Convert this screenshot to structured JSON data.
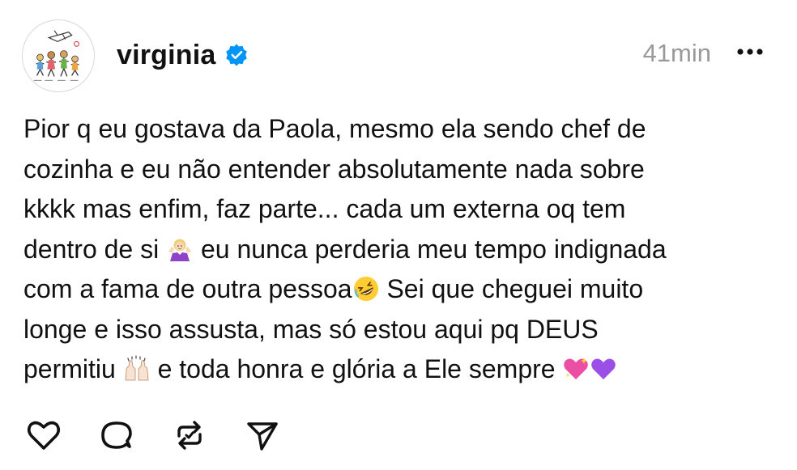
{
  "post": {
    "username": "virginia",
    "verified": true,
    "timestamp": "41min",
    "more_icon": "more-horizontal-icon",
    "text_lines": [
      {
        "text": "Pior q eu gostava da Paola, mesmo ela sendo chef de"
      },
      {
        "text": "cozinha e eu não entender absolutamente nada sobre"
      },
      {
        "text": "kkkk mas enfim, faz parte... cada um externa oq tem"
      },
      {
        "before": "dentro de si ",
        "emoji": "woman-shrugging-emoji",
        "after": " eu nunca perderia meu tempo indignada"
      },
      {
        "before": "com a fama de outra pessoa",
        "emoji": "rolling-laughing-emoji",
        "after": " Sei que cheguei muito"
      },
      {
        "text": "longe e isso assusta, mas só estou aqui pq DEUS"
      },
      {
        "before": "permitiu ",
        "emoji": "raising-hands-emoji",
        "after": " e toda honra e glória a Ele sempre ",
        "emoji2": "sparkling-heart-emoji",
        "emoji3": "purple-heart-emoji"
      }
    ],
    "actions": [
      {
        "name": "like-button",
        "icon": "heart-icon"
      },
      {
        "name": "comment-button",
        "icon": "comment-icon"
      },
      {
        "name": "repost-button",
        "icon": "repost-icon"
      },
      {
        "name": "share-button",
        "icon": "send-icon"
      }
    ],
    "colors": {
      "text": "#111111",
      "muted": "#999999",
      "verified_blue": "#0095f6"
    }
  }
}
